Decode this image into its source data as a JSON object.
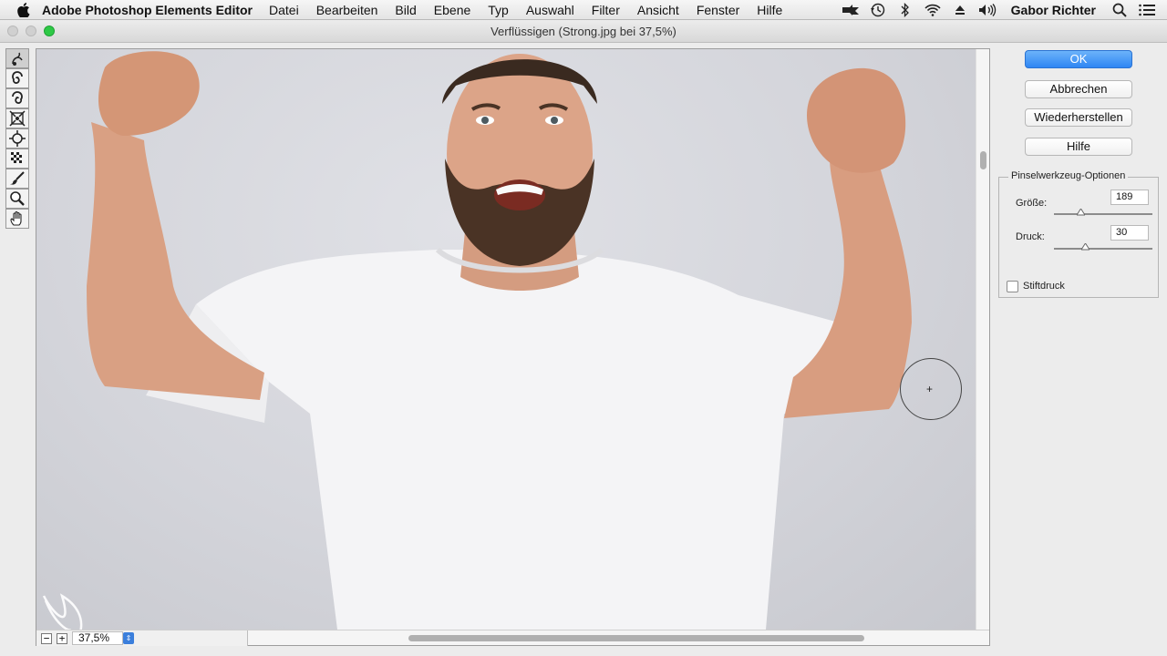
{
  "menubar": {
    "app_name": "Adobe Photoshop Elements Editor",
    "items": [
      "Datei",
      "Bearbeiten",
      "Bild",
      "Ebene",
      "Typ",
      "Auswahl",
      "Filter",
      "Ansicht",
      "Fenster",
      "Hilfe"
    ],
    "user": "Gabor Richter"
  },
  "window": {
    "title": "Verflüssigen (Strong.jpg bei 37,5%)"
  },
  "buttons": {
    "ok": "OK",
    "cancel": "Abbrechen",
    "restore": "Wiederherstellen",
    "help": "Hilfe"
  },
  "brush_options": {
    "legend": "Pinselwerkzeug-Optionen",
    "size_label": "Größe:",
    "size_value": "189",
    "size_fraction": 0.25,
    "pressure_label": "Druck:",
    "pressure_value": "30",
    "pressure_fraction": 0.3,
    "pen_pressure_label": "Stiftdruck",
    "pen_pressure_checked": false
  },
  "zoom": {
    "minus": "−",
    "plus": "+",
    "value": "37,5%"
  },
  "colors": {
    "accent": "#2f86f3",
    "zoom_green": "#2ec946"
  }
}
